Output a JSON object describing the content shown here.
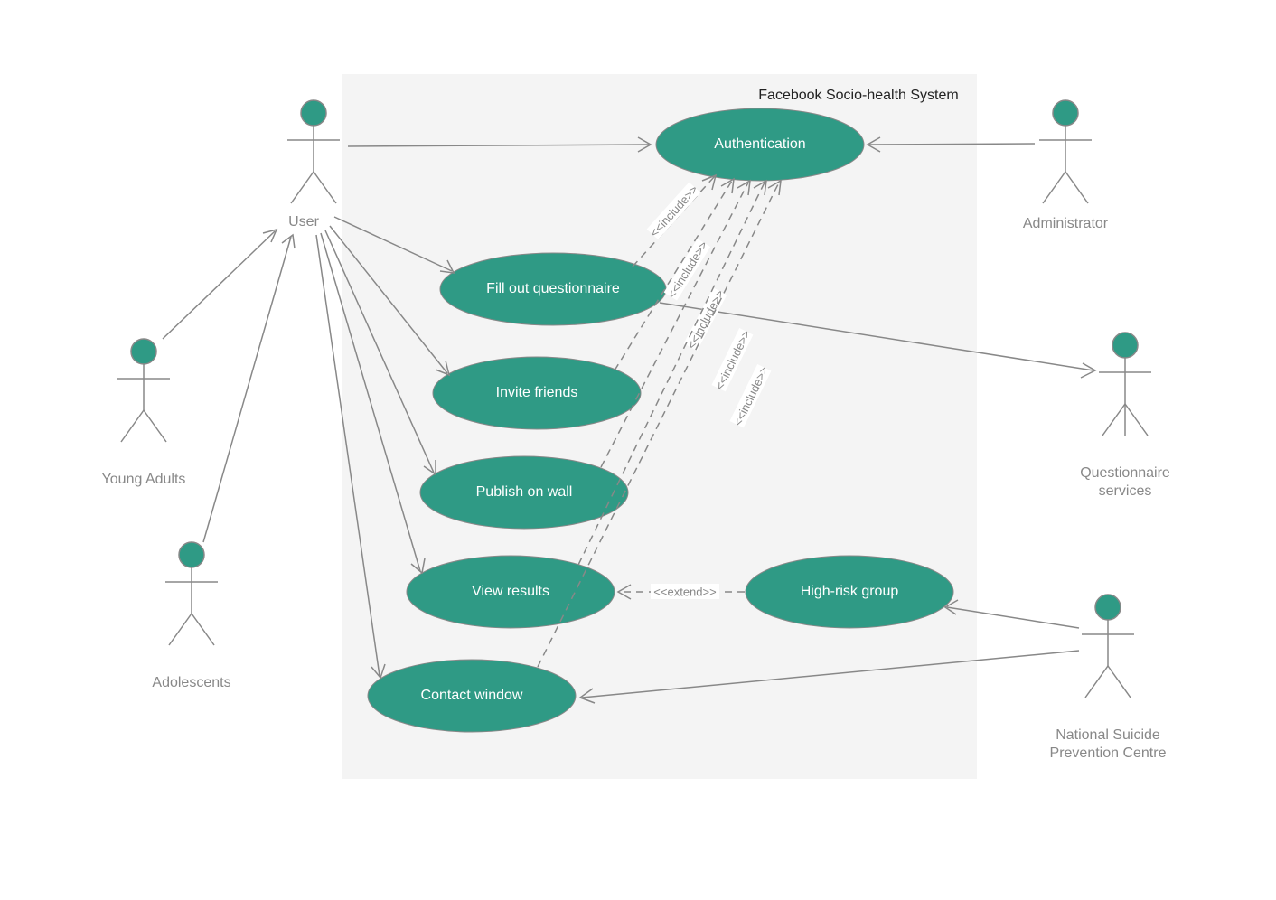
{
  "diagram": {
    "boundary_title": "Facebook Socio-health System",
    "actors": {
      "user": "User",
      "young_adults": "Young Adults",
      "adolescents": "Adolescents",
      "administrator": "Administrator",
      "questionnaire_services": "Questionnaire\nservices",
      "nspc": "National Suicide\nPrevention Centre"
    },
    "usecases": {
      "authentication": "Authentication",
      "fill_questionnaire": "Fill out questionnaire",
      "invite_friends": "Invite friends",
      "publish_wall": "Publish on wall",
      "view_results": "View results",
      "contact_window": "Contact window",
      "high_risk": "High-risk group"
    },
    "stereotypes": {
      "include": "<<include>>",
      "extend": "<<extend>>"
    },
    "colors": {
      "usecase_fill": "#2f9a85",
      "boundary_fill": "#f4f4f4",
      "line": "#888888"
    }
  }
}
